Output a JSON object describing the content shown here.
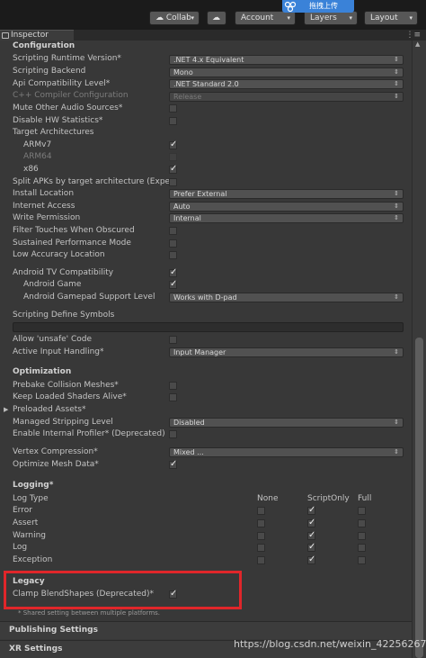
{
  "toolbar": {
    "collab_label": "Collab",
    "account_label": "Account",
    "layers_label": "Layers",
    "layout_label": "Layout",
    "upload_label": "拖拽上传"
  },
  "tab": {
    "inspector_label": "Inspector"
  },
  "configuration": {
    "heading": "Configuration",
    "scripting_runtime_label": "Scripting Runtime Version*",
    "scripting_runtime_value": ".NET 4.x Equivalent",
    "scripting_backend_label": "Scripting Backend",
    "scripting_backend_value": "Mono",
    "api_compat_label": "Api Compatibility Level*",
    "api_compat_value": ".NET Standard 2.0",
    "cpp_compiler_label": "C++ Compiler Configuration",
    "cpp_compiler_value": "Release",
    "mute_audio_label": "Mute Other Audio Sources*",
    "disable_hw_stats_label": "Disable HW Statistics*",
    "target_arch_label": "Target Architectures",
    "armv7_label": "ARMv7",
    "arm64_label": "ARM64",
    "x86_label": "x86",
    "split_apks_label": "Split APKs by target architecture (Exper",
    "install_location_label": "Install Location",
    "install_location_value": "Prefer External",
    "internet_access_label": "Internet Access",
    "internet_access_value": "Auto",
    "write_permission_label": "Write Permission",
    "write_permission_value": "Internal",
    "filter_touches_label": "Filter Touches When Obscured",
    "sustained_perf_label": "Sustained Performance Mode",
    "low_accuracy_label": "Low Accuracy Location",
    "android_tv_label": "Android TV Compatibility",
    "android_game_label": "Android Game",
    "gamepad_support_label": "Android Gamepad Support Level",
    "gamepad_support_value": "Works with D-pad",
    "scripting_define_label": "Scripting Define Symbols",
    "allow_unsafe_label": "Allow 'unsafe' Code",
    "active_input_label": "Active Input Handling*",
    "active_input_value": "Input Manager"
  },
  "optimization": {
    "heading": "Optimization",
    "prebake_label": "Prebake Collision Meshes*",
    "keep_shaders_label": "Keep Loaded Shaders Alive*",
    "preloaded_assets_label": "Preloaded Assets*",
    "managed_stripping_label": "Managed Stripping Level",
    "managed_stripping_value": "Disabled",
    "internal_profiler_label": "Enable Internal Profiler* (Deprecated)",
    "vertex_compression_label": "Vertex Compression*",
    "vertex_compression_value": "Mixed ...",
    "optimize_mesh_label": "Optimize Mesh Data*"
  },
  "logging": {
    "heading": "Logging*",
    "log_type_label": "Log Type",
    "col_none": "None",
    "col_scriptonly": "ScriptOnly",
    "col_full": "Full",
    "rows": [
      "Error",
      "Assert",
      "Warning",
      "Log",
      "Exception"
    ]
  },
  "legacy": {
    "heading": "Legacy",
    "clamp_blendshapes_label": "Clamp BlendShapes (Deprecated)*"
  },
  "shared_note": "* Shared setting between multiple platforms.",
  "sections": {
    "publishing_label": "Publishing Settings",
    "xr_label": "XR Settings"
  },
  "watermark": "https://blog.csdn.net/weixin_42256267",
  "colors": {
    "highlight_border": "#e0262a",
    "upload_pill": "#3a82d8",
    "panel_bg": "#383838"
  }
}
